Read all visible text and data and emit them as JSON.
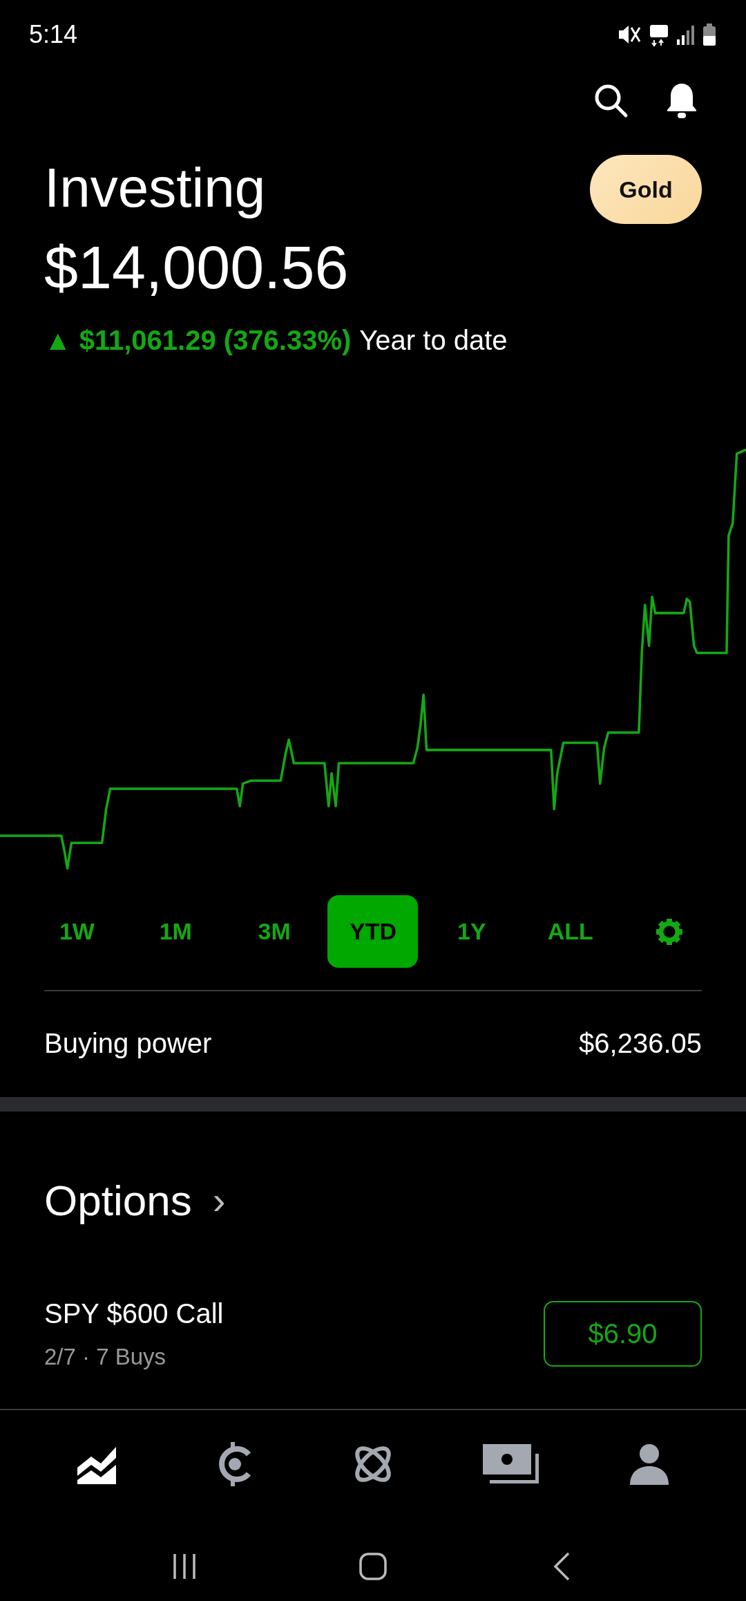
{
  "status_bar": {
    "time": "5:14"
  },
  "header": {
    "title": "Investing",
    "badge": "Gold",
    "value": "$14,000.56"
  },
  "change": {
    "arrow": "▲",
    "amount": "$11,061.29 (376.33%)",
    "period": "Year to date"
  },
  "ranges": [
    {
      "label": "1W",
      "selected": false
    },
    {
      "label": "1M",
      "selected": false
    },
    {
      "label": "3M",
      "selected": false
    },
    {
      "label": "YTD",
      "selected": true
    },
    {
      "label": "1Y",
      "selected": false
    },
    {
      "label": "ALL",
      "selected": false
    }
  ],
  "buying_power": {
    "label": "Buying power",
    "value": "$6,236.05"
  },
  "options": {
    "title": "Options",
    "chevron": "›",
    "positions": [
      {
        "name": "SPY $600 Call",
        "detail": "2/7 · 7 Buys",
        "price": "$6.90"
      }
    ]
  },
  "bottom_nav": [
    {
      "selected": true
    },
    {
      "selected": false
    },
    {
      "selected": false
    },
    {
      "selected": false
    },
    {
      "selected": false
    }
  ]
}
